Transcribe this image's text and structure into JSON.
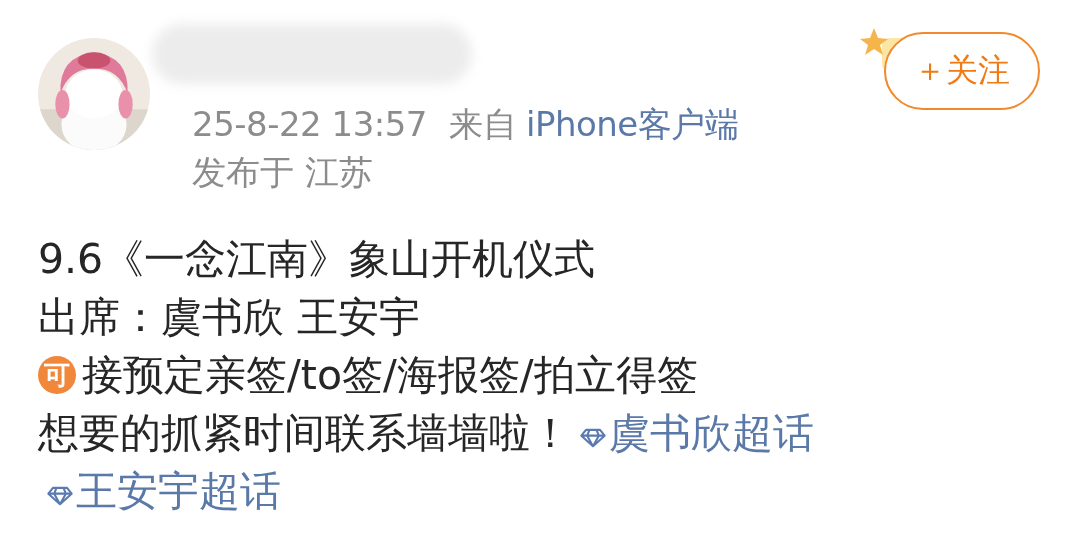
{
  "post": {
    "follow_button": {
      "label": "＋关注"
    },
    "time": "25-8-22 13:57",
    "source_prefix": "来自",
    "source": "iPhone客户端",
    "location": "发布于 江苏",
    "lines": [
      {
        "kind": "text",
        "text": "9.6《一念江南》象山开机仪式"
      },
      {
        "kind": "text",
        "text": "出席：虞书欣 王安宇"
      },
      {
        "kind": "badge",
        "badge": "可",
        "text": "接预定亲签/to签/海报签/拍立得签"
      },
      {
        "kind": "topics",
        "text": "想要的抓紧时间联系墙墙啦！",
        "topics": [
          "虞书欣超话",
          "王安宇超话"
        ]
      }
    ]
  }
}
